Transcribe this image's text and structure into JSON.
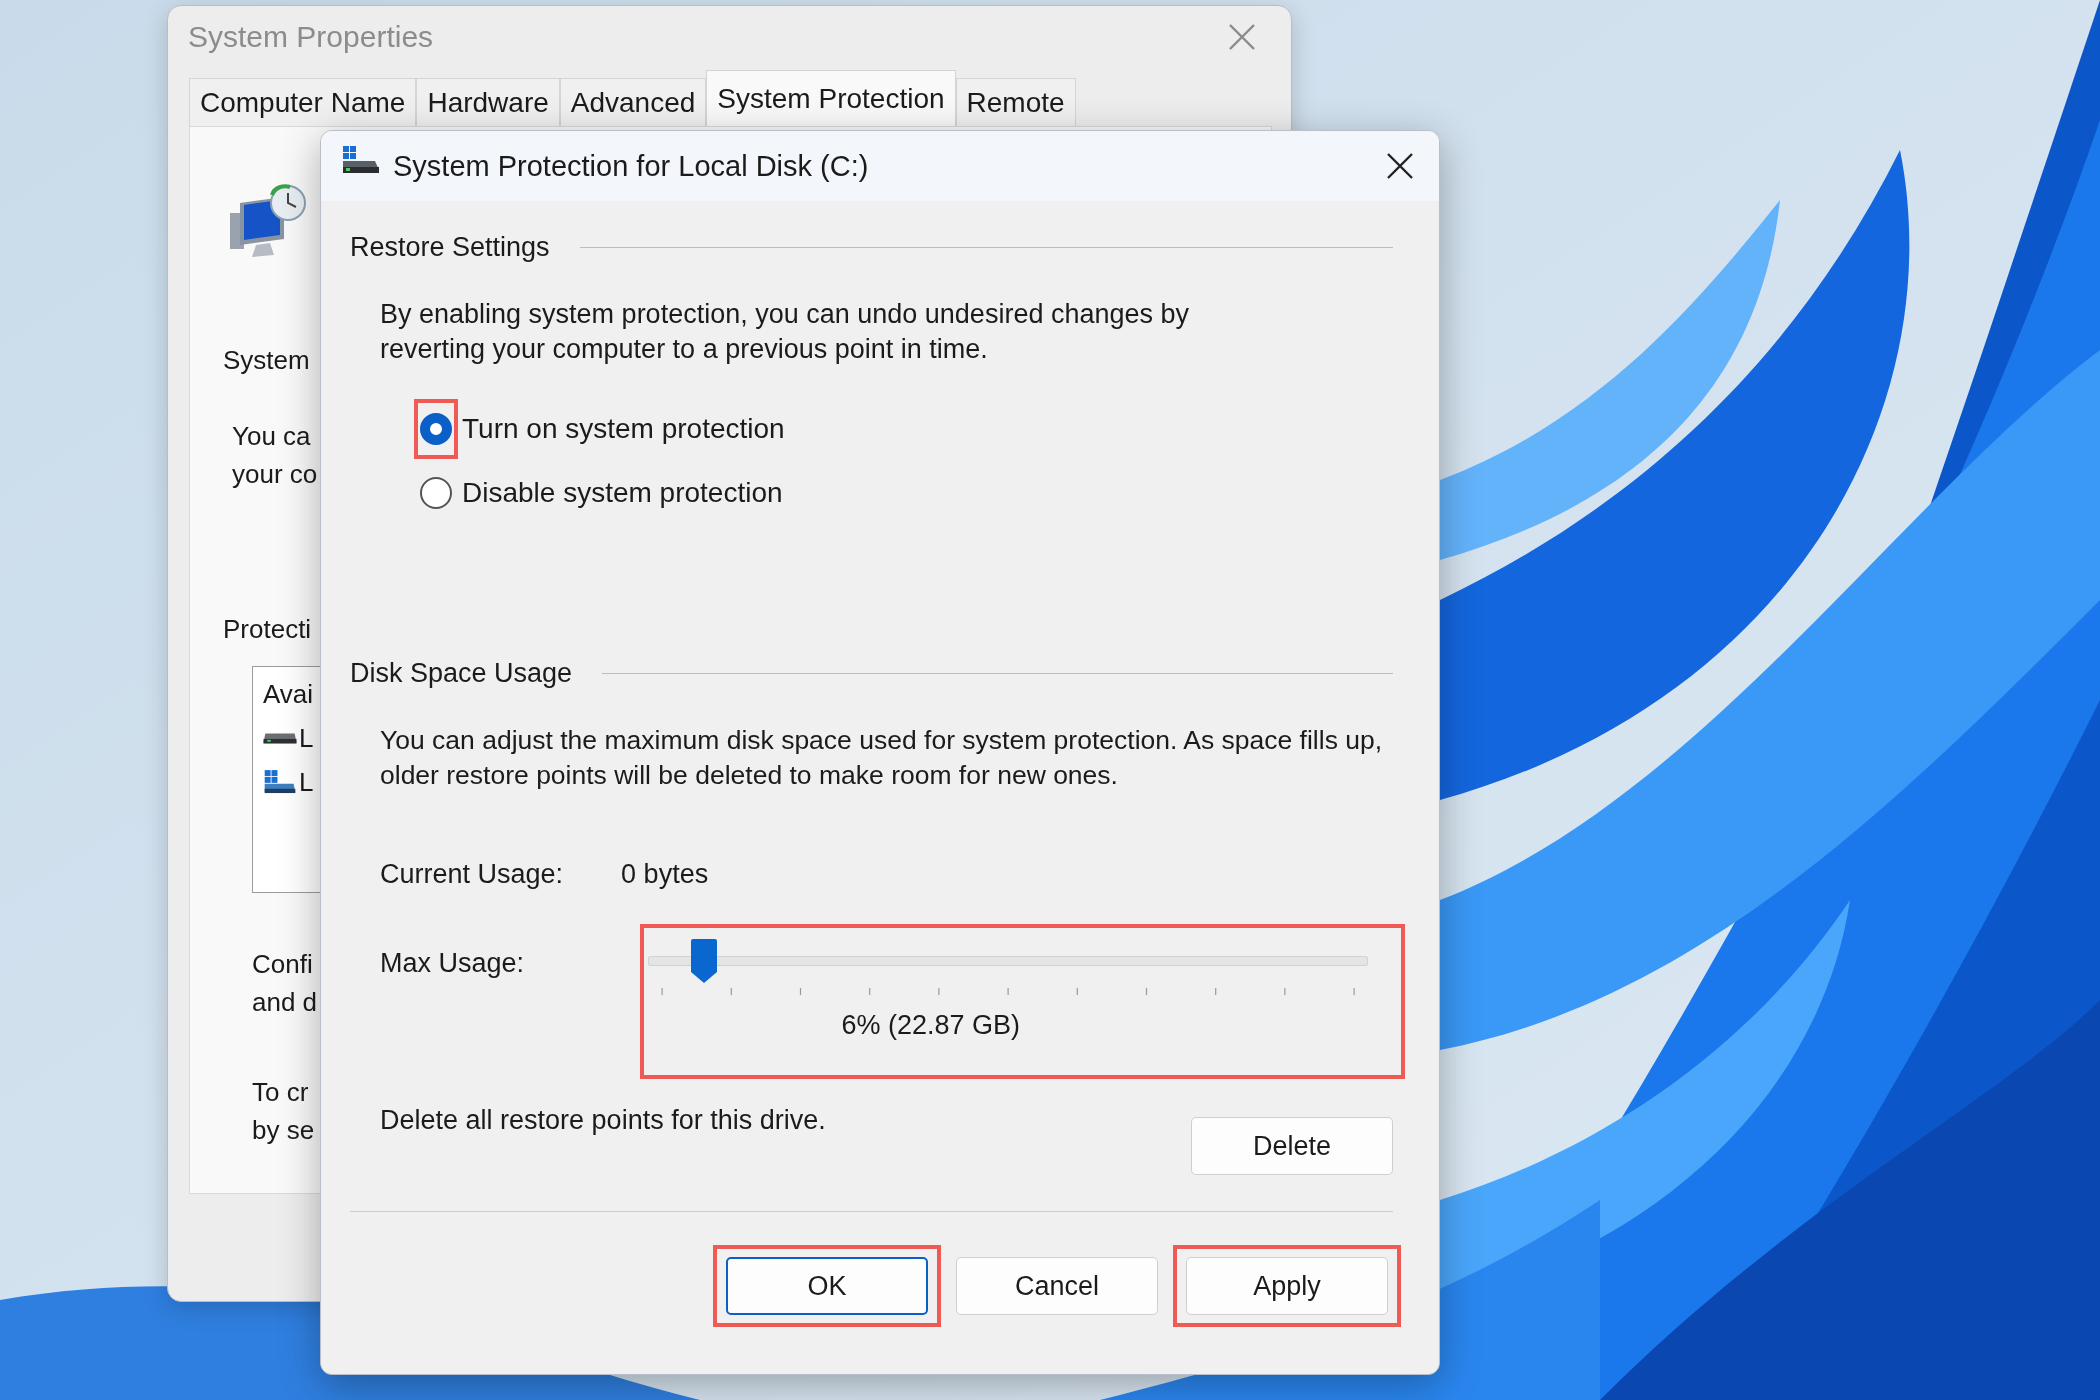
{
  "background_window": {
    "title": "System Properties",
    "tabs": [
      {
        "label": "Computer Name",
        "selected": false
      },
      {
        "label": "Hardware",
        "selected": false
      },
      {
        "label": "Advanced",
        "selected": false
      },
      {
        "label": "System Protection",
        "selected": true
      },
      {
        "label": "Remote",
        "selected": false
      }
    ],
    "heading": "System",
    "description_lines": [
      "You ca",
      "your co"
    ],
    "section_label": "Protecti",
    "list": {
      "header": "Avai",
      "drives": [
        {
          "label": "L",
          "kind": "drive"
        },
        {
          "label": "L",
          "kind": "system-drive"
        }
      ]
    },
    "configure_lines": [
      "Confi",
      "and d"
    ],
    "create_lines": [
      "To cr",
      "by se"
    ]
  },
  "dialog": {
    "title": "System Protection for Local Disk (C:)",
    "restore_settings": {
      "heading": "Restore Settings",
      "description": "By enabling system protection, you can undo undesired changes by reverting your computer to a previous point in time.",
      "options": [
        {
          "label": "Turn on system protection",
          "selected": true,
          "highlighted": true
        },
        {
          "label": "Disable system protection",
          "selected": false,
          "highlighted": false
        }
      ]
    },
    "disk_space_usage": {
      "heading": "Disk Space Usage",
      "description": "You can adjust the maximum disk space used for system protection. As space fills up, older restore points will be deleted to make room for new ones.",
      "current_usage": {
        "label": "Current Usage:",
        "value": "0 bytes"
      },
      "max_usage": {
        "label": "Max Usage:",
        "level": 0.06,
        "reading": "6% (22.87 GB)",
        "highlighted": true
      },
      "delete": {
        "description": "Delete all restore points for this drive.",
        "button": "Delete"
      }
    },
    "buttons": [
      {
        "label": "OK",
        "default": true,
        "highlighted": true
      },
      {
        "label": "Cancel",
        "default": false,
        "highlighted": false
      },
      {
        "label": "Apply",
        "default": false,
        "highlighted": true
      }
    ]
  }
}
